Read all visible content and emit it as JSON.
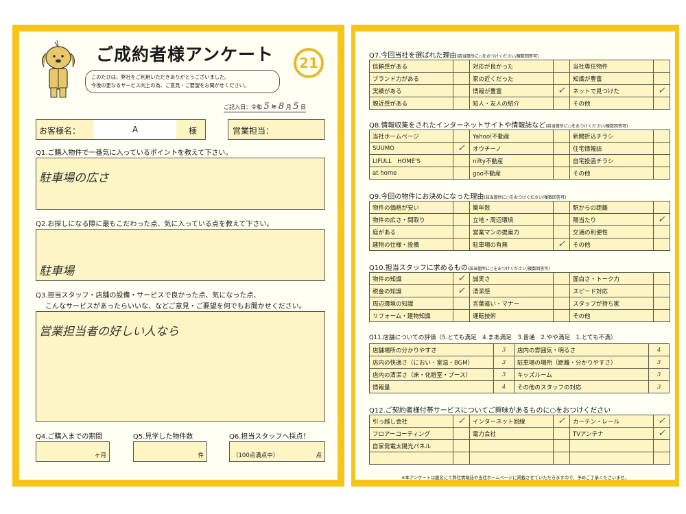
{
  "left": {
    "title": "ご成約者様アンケート",
    "greeting": [
      "このたびは、弊社をご利用いただきありがとうございました。",
      "今後の更なるサービス向上の為、ご意見・ご要望をお聞かせください。"
    ],
    "logo_number": "21",
    "date": {
      "prefix": "ご記入日：令和",
      "year": "5",
      "year_unit": "年",
      "month": "8",
      "month_unit": "月",
      "day": "5",
      "day_unit": "日"
    },
    "customer_label": "お客様名：",
    "customer_name": "A",
    "honorific": "様",
    "staff_label": "営業担当：",
    "q1": {
      "label": "Q1.ご購入物件で一番気に入っているポイントを教えて下さい。",
      "answer": "駐車場の広さ"
    },
    "q2": {
      "label": "Q2.お探しになる際に最もこだわった点、気に入っている点を教えて下さい。",
      "answer": "駐車場"
    },
    "q3": {
      "label1": "Q3.担当スタッフ・店舗の設備・サービスで良かった点、気になった点、",
      "label2": "こんなサービスがあったらいいな、などご意見・ご要望を何でもお聞かせください。",
      "answer": "営業担当者の好しい人なら"
    },
    "q4": {
      "label": "Q4.ご購入までの期間",
      "unit": "ヶ月"
    },
    "q5": {
      "label": "Q5.見学した物件数",
      "unit": "件"
    },
    "q6": {
      "label": "Q6.担当スタッフへ採点！",
      "note": "（100点満点中）",
      "unit": "点"
    }
  },
  "right": {
    "q7": {
      "title": "Q7.今回当社を選ばれた理由",
      "sub": "(該当箇所に○をおつけください/複数回答可)",
      "rows": [
        [
          {
            "t": "信頼感がある",
            "c": ""
          },
          {
            "t": "対応が良かった",
            "c": ""
          },
          {
            "t": "当社専任物件",
            "c": ""
          }
        ],
        [
          {
            "t": "ブランド力がある",
            "c": ""
          },
          {
            "t": "家の近くだった",
            "c": ""
          },
          {
            "t": "知識が豊富",
            "c": ""
          }
        ],
        [
          {
            "t": "実績がある",
            "c": ""
          },
          {
            "t": "情報が豊富",
            "c": "✓"
          },
          {
            "t": "ネットで見つけた",
            "c": "✓"
          }
        ],
        [
          {
            "t": "親近感がある",
            "c": ""
          },
          {
            "t": "知人・友人の紹介",
            "c": ""
          },
          {
            "t": "その他",
            "c": ""
          }
        ]
      ]
    },
    "q8": {
      "title": "Q8.情報収集をされたインターネットサイトや情報誌など",
      "sub": "(該当箇所に○をおつけください/複数回答可)",
      "rows": [
        [
          {
            "t": "当社ホームページ",
            "c": ""
          },
          {
            "t": "Yahoo!不動産",
            "c": ""
          },
          {
            "t": "新聞折込チラシ",
            "c": ""
          }
        ],
        [
          {
            "t": "SUUMO",
            "c": "✓"
          },
          {
            "t": "オウチーノ",
            "c": ""
          },
          {
            "t": "住宅情報誌",
            "c": ""
          }
        ],
        [
          {
            "t": "LIFULL　HOME'S",
            "c": ""
          },
          {
            "t": "nifty不動産",
            "c": ""
          },
          {
            "t": "自宅投函チラシ",
            "c": ""
          }
        ],
        [
          {
            "t": "at home",
            "c": ""
          },
          {
            "t": "goo不動産",
            "c": ""
          },
          {
            "t": "その他",
            "c": ""
          }
        ]
      ]
    },
    "q9": {
      "title": "Q9.今回の物件にお決めになった理由",
      "sub": "(該当箇所に○をおつけください/複数回答可)",
      "rows": [
        [
          {
            "t": "物件の価格が安い",
            "c": ""
          },
          {
            "t": "築年数",
            "c": ""
          },
          {
            "t": "駅からの距離",
            "c": ""
          }
        ],
        [
          {
            "t": "物件の広さ・間取り",
            "c": ""
          },
          {
            "t": "立地・周辺環境",
            "c": ""
          },
          {
            "t": "陽当たり",
            "c": "✓"
          }
        ],
        [
          {
            "t": "庭がある",
            "c": ""
          },
          {
            "t": "営業マンの提案力",
            "c": ""
          },
          {
            "t": "交通の利便性",
            "c": ""
          }
        ],
        [
          {
            "t": "建物の仕様・設備",
            "c": ""
          },
          {
            "t": "駐車場の有無",
            "c": "✓"
          },
          {
            "t": "その他",
            "c": ""
          }
        ]
      ]
    },
    "q10": {
      "title": "Q10.担当スタッフに求めるもの",
      "sub": "(該当箇所に○をおつけください/複数回答可)",
      "rows": [
        [
          {
            "t": "物件の知識",
            "c": "✓"
          },
          {
            "t": "誠実さ",
            "c": ""
          },
          {
            "t": "面白さ・トーク力",
            "c": ""
          }
        ],
        [
          {
            "t": "税金の知識",
            "c": "✓"
          },
          {
            "t": "清潔感",
            "c": ""
          },
          {
            "t": "スピード対応",
            "c": ""
          }
        ],
        [
          {
            "t": "周辺環境の知識",
            "c": ""
          },
          {
            "t": "言葉遣い・マナー",
            "c": ""
          },
          {
            "t": "スタッフが持ち家",
            "c": ""
          }
        ],
        [
          {
            "t": "リフォーム・建物知識",
            "c": ""
          },
          {
            "t": "運転技術",
            "c": ""
          },
          {
            "t": "その他",
            "c": ""
          }
        ]
      ]
    },
    "q11": {
      "title": "Q11.店舗についての評価（5.とても満足　4.まあ満足　3.普通　2.やや満足　1.とても不満）",
      "rows": [
        [
          {
            "t": "店舗場所の分かりやすさ",
            "v": "3"
          },
          {
            "t": "店内の雰囲気・明るさ",
            "v": "4"
          }
        ],
        [
          {
            "t": "店内の快適さ（におい・室温・BGM）",
            "v": "3"
          },
          {
            "t": "駐車場の場所（距離・分かりやすさ）",
            "v": "3"
          }
        ],
        [
          {
            "t": "店内の清潔さ（床・化粧室・ブース）",
            "v": "3"
          },
          {
            "t": "キッズルーム",
            "v": "3"
          }
        ],
        [
          {
            "t": "情報量",
            "v": "4"
          },
          {
            "t": "その他のスタッフの対応",
            "v": "3"
          }
        ]
      ]
    },
    "q12": {
      "title": "Q12.ご契約者様付帯サービスについてご興味があるものに○をおつけください",
      "rows": [
        [
          {
            "t": "引っ越し会社",
            "c": "✓"
          },
          {
            "t": "インターネット回線",
            "c": "✓"
          },
          {
            "t": "カーテン・レール",
            "c": "✓"
          }
        ],
        [
          {
            "t": "フロアーコーティング",
            "c": ""
          },
          {
            "t": "電力会社",
            "c": ""
          },
          {
            "t": "TVアンテナ",
            "c": "✓"
          }
        ],
        [
          {
            "t": "自家発電太陽光パネル",
            "c": ""
          },
          {
            "t": "",
            "c": ""
          },
          {
            "t": "",
            "c": ""
          }
        ],
        [
          {
            "t": "",
            "c": ""
          },
          {
            "t": "",
            "c": ""
          },
          {
            "t": "",
            "c": ""
          }
        ]
      ]
    },
    "footer": "※本アンケートは匿名にて弊社情報誌や当社ホームページに掲載させていただきますので、予めご了承くださいませ。"
  },
  "colors": {
    "frame": "#f6c51b",
    "field": "#fdf6c4",
    "logo": "#e9b82a"
  }
}
